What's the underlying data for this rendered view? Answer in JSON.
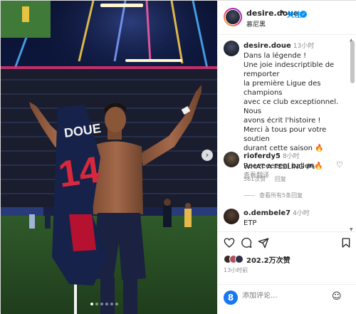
{
  "header": {
    "username": "desire.doue",
    "separator": "•",
    "follow_label": "关注",
    "location": "慕尼黑"
  },
  "caption": {
    "username": "desire.doue",
    "time": "13小时",
    "lines": [
      "Dans la légende !",
      "Une joie indescriptible de remporter",
      "la première Ligue des champions",
      "avec ce club exceptionnel. Nous",
      "avons écrit l'histoire !",
      "Merci à tous pour votre soutien",
      "durant cette saison 🔥"
    ],
    "tagline": "WHAT A FEELING 🎮",
    "see_translation": "查看翻译"
  },
  "comments": [
    {
      "username": "rioferdy5",
      "time": "8小时",
      "text": "Reeeeeeeeal baller 🔥",
      "likes": "561次赞",
      "reply": "回复",
      "view_replies": "查看所有5条回复"
    },
    {
      "username": "o.dembele7",
      "time": "4小时",
      "text": "ETP"
    }
  ],
  "actions": {
    "like_icon": "heart-icon",
    "comment_icon": "comment-icon",
    "share_icon": "share-icon",
    "save_icon": "bookmark-icon"
  },
  "likes_count": "202.2万次赞",
  "posted_ago": "13小时前",
  "comment_input": {
    "placeholder": "添加评论..."
  },
  "photo": {
    "jersey_name": "DOUE",
    "jersey_number": "14",
    "carousel_dots": 6,
    "active_dot": 0
  },
  "colors": {
    "link_blue": "#0095f6",
    "verified_blue": "#0095f6",
    "text": "#262626",
    "muted": "#8e8e8e"
  }
}
